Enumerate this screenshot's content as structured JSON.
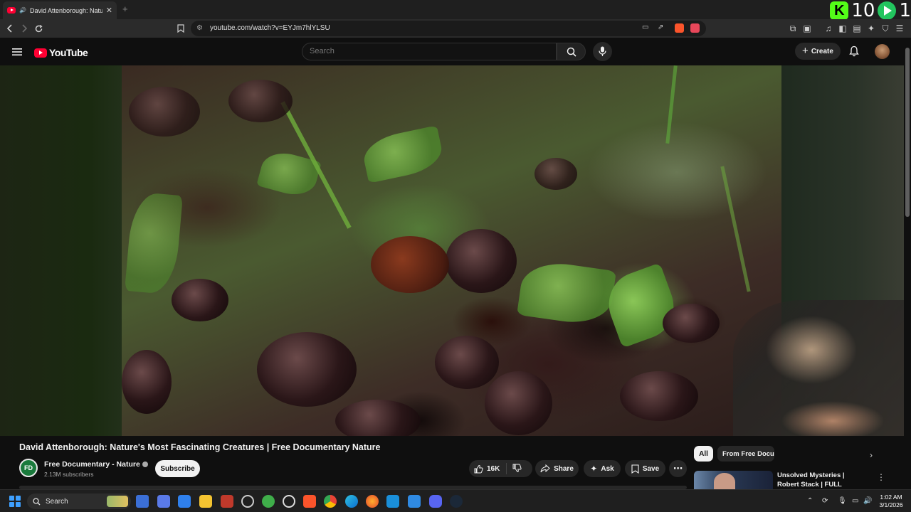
{
  "browser": {
    "tab_title": "David Attenborough: Nature's",
    "new_tab": "+",
    "url": "youtube.com/watch?v=EYJm7hlYLSU",
    "streak": {
      "left_value": "10",
      "right_value": "1"
    }
  },
  "youtube": {
    "logo_text": "YouTube",
    "search_placeholder": "Search",
    "create_label": "Create"
  },
  "video": {
    "title": "David Attenborough: Nature's Most Fascinating Creatures | Free Documentary Nature",
    "channel_name": "Free Documentary - Nature",
    "channel_avatar_text": "FD",
    "subscribers": "2.13M subscribers",
    "subscribe_label": "Subscribe",
    "like_count": "16K",
    "share_label": "Share",
    "ask_label": "Ask",
    "save_label": "Save"
  },
  "sidebar": {
    "chips": [
      "All",
      "From Free Docu"
    ],
    "recommendation_title": "Unsolved Mysteries | Robert Stack | FULL EPISODES |..."
  },
  "taskbar": {
    "search_label": "Search",
    "time": "1:02 AM",
    "date": "3/1/2026"
  },
  "colors": {
    "yt_red": "#ff0033",
    "kick_green": "#53fc18",
    "bg": "#0f0f0f"
  }
}
